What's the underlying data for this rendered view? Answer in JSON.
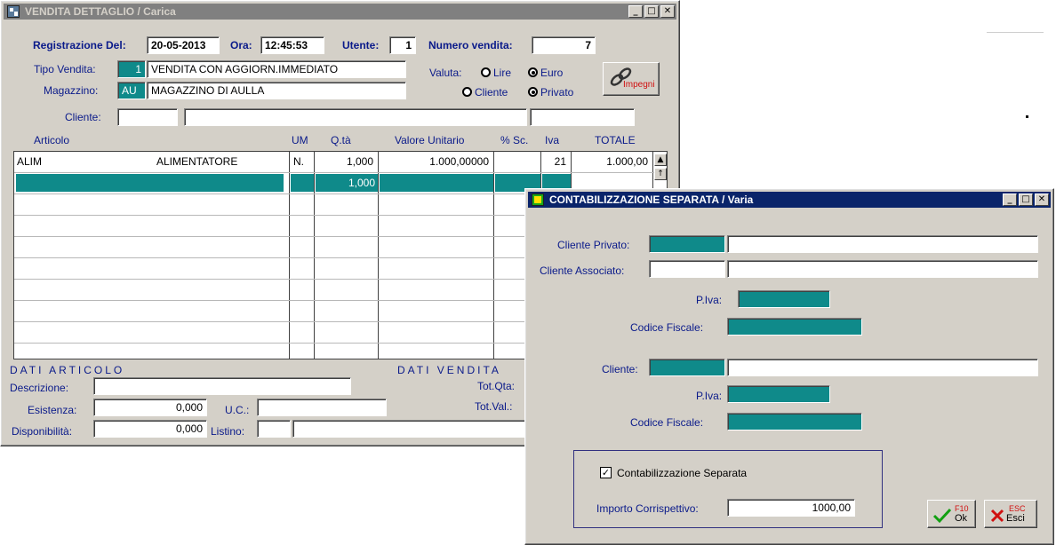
{
  "main_window": {
    "title": "VENDITA DETTAGLIO / Carica",
    "registrazione_label": "Registrazione Del:",
    "registrazione_value": "20-05-2013",
    "ora_label": "Ora:",
    "ora_value": "12:45:53",
    "utente_label": "Utente:",
    "utente_value": "1",
    "numero_vendita_label": "Numero vendita:",
    "numero_vendita_value": "7",
    "tipo_vendita_label": "Tipo Vendita:",
    "tipo_vendita_code": "1",
    "tipo_vendita_desc": "VENDITA CON AGGIORN.IMMEDIATO",
    "magazzino_label": "Magazzino:",
    "magazzino_code": "AU",
    "magazzino_desc": "MAGAZZINO DI AULLA",
    "valuta_label": "Valuta:",
    "radio_lire": "Lire",
    "radio_euro": "Euro",
    "radio_cliente": "Cliente",
    "radio_privato": "Privato",
    "impegni_label": "Impegni",
    "cliente_label": "Cliente:",
    "columns": {
      "articolo": "Articolo",
      "um": "UM",
      "qta": "Q.tà",
      "valore": "Valore Unitario",
      "sc": "% Sc.",
      "iva": "Iva",
      "totale": "TOTALE"
    },
    "row1": {
      "codice": "ALIM",
      "descrizione": "ALIMENTATORE",
      "um": "N.",
      "qta": "1,000",
      "valore": "1.000,00000",
      "iva": "21",
      "totale": "1.000,00"
    },
    "row2": {
      "qta": "1,000"
    },
    "dati_articolo": "DATI ARTICOLO",
    "dati_vendita": "DATI VENDITA",
    "descrizione_label": "Descrizione:",
    "esistenza_label": "Esistenza:",
    "esistenza_value": "0,000",
    "uc_label": "U.C.:",
    "disponibilita_label": "Disponibilità:",
    "disponibilita_value": "0,000",
    "listino_label": "Listino:",
    "tot_qta_label": "Tot.Qta:",
    "tot_val_label": "Tot.Val.:"
  },
  "dialog": {
    "title": "CONTABILIZZAZIONE SEPARATA / Varia",
    "cliente_privato_label": "Cliente Privato:",
    "cliente_associato_label": "Cliente Associato:",
    "piva_label": "P.Iva:",
    "codice_fiscale_label": "Codice Fiscale:",
    "cliente_label": "Cliente:",
    "piva2_label": "P.Iva:",
    "codice_fiscale2_label": "Codice Fiscale:",
    "contabilizzazione_label": "Contabilizzazione Separata",
    "contabilizzazione_checked": true,
    "importo_label": "Importo Corrispettivo:",
    "importo_value": "1000,00",
    "ok_key": "F10",
    "ok_label": "Ok",
    "esci_key": "ESC",
    "esci_label": "Esci"
  },
  "icons": [
    "app-icon",
    "minimize-icon",
    "maximize-icon",
    "close-icon",
    "chain-link-icon",
    "check-icon",
    "x-icon",
    "scroll-up-icon"
  ],
  "colors": {
    "teal": "#0f8a8a",
    "active_title": "#0a246a",
    "inactive_title": "#808080",
    "label_blue": "#0a1a8a"
  }
}
